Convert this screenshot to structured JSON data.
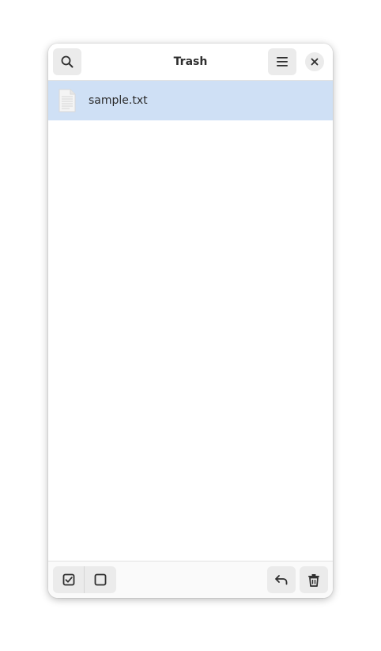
{
  "window": {
    "title": "Trash"
  },
  "headerbar": {
    "search_icon": "search-icon",
    "menu_icon": "hamburger-menu-icon",
    "close_icon": "close-icon"
  },
  "files": [
    {
      "name": "sample.txt",
      "icon": "text-document-icon",
      "selected": true
    }
  ],
  "actionbar": {
    "select_all_icon": "checkbox-checked-icon",
    "select_none_icon": "checkbox-empty-icon",
    "restore_icon": "undo-arrow-icon",
    "delete_icon": "trash-icon"
  },
  "colors": {
    "selection": "#cfe0f5",
    "button_bg": "#ebebeb",
    "text": "#2e2e2e"
  }
}
